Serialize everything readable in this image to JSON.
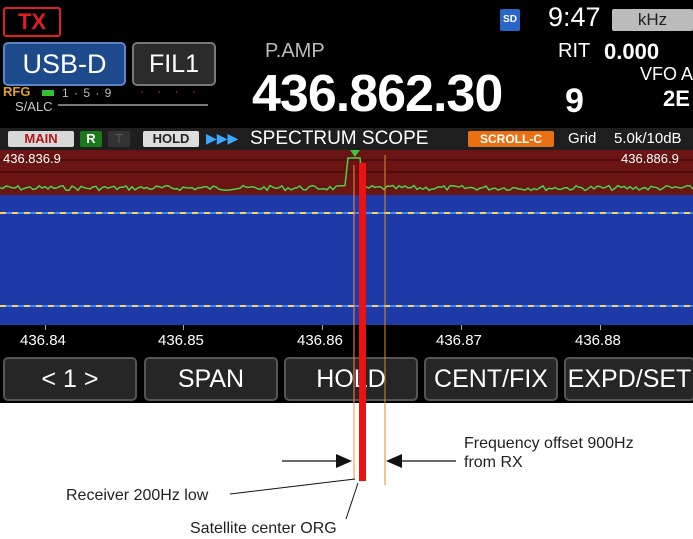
{
  "status": {
    "tx": "TX",
    "sd": "SD",
    "clock": "9:47",
    "unit": "kHz"
  },
  "controls": {
    "mode": "USB-D",
    "filter": "FIL1",
    "rfg": "RFG",
    "salc": "S/ALC",
    "meter_scale": "1 · 5 · 9",
    "meter_dots": "· · · ·"
  },
  "display": {
    "pamp": "P.AMP",
    "frequency_main": "436.862.30",
    "frequency_small": "9",
    "rit_label": "RIT",
    "rit_value": "0.000",
    "vfo_label": "VFO A",
    "vfo_num": "2E"
  },
  "scope_bar": {
    "main": "MAIN",
    "r": "R",
    "t": "T",
    "hold": "HOLD",
    "arrows": "▶▶▶",
    "title": "SPECTRUM SCOPE",
    "scroll": "SCROLL-C",
    "grid": "Grid",
    "span": "5.0k/10dB"
  },
  "scope": {
    "freq_left": "436.836.9",
    "freq_right": "436.886.9",
    "ticks": [
      "436.84",
      "436.85",
      "436.86",
      "436.87",
      "436.88"
    ]
  },
  "softkeys": [
    "< 1 >",
    "SPAN",
    "HOLD",
    "CENT/FIX",
    "EXPD/SET"
  ],
  "annotations": {
    "offset_line1": "Frequency offset  900Hz",
    "offset_line2": "from RX",
    "receiver": "Receiver 200Hz low",
    "satellite": "Satellite center ORG"
  },
  "colors": {
    "tx_red": "#e02020",
    "marker_red": "#ee1111",
    "offset_orange": "#e08a20",
    "waterfall_blue": "#1e3aa6",
    "spectrum_maroon": "#6a1414"
  }
}
